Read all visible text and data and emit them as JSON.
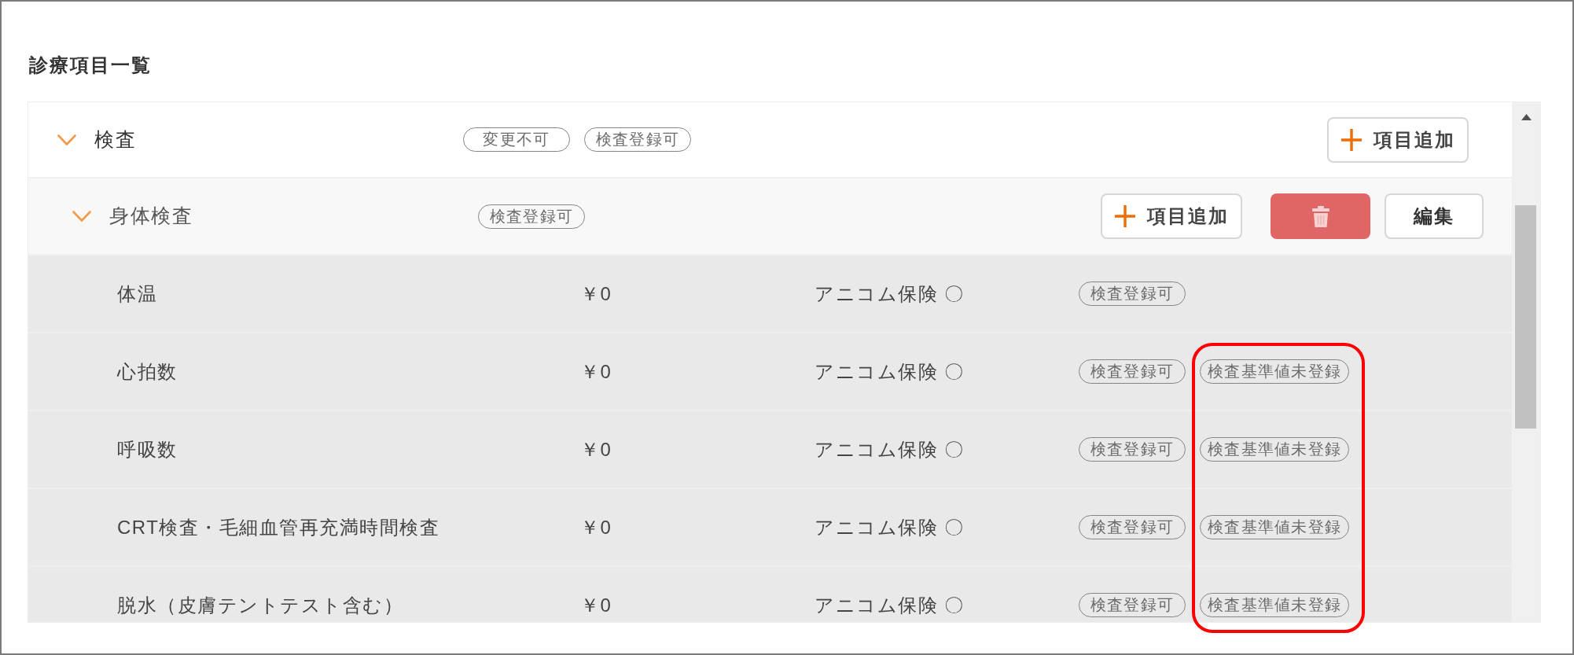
{
  "title": "診療項目一覧",
  "categories": [
    {
      "name": "検査",
      "expanded": true,
      "tags": [
        "変更不可",
        "検査登録可"
      ],
      "add_button": "項目追加",
      "children": [
        {
          "name": "身体検査",
          "expanded": true,
          "tags": [
            "検査登録可"
          ],
          "add_button": "項目追加",
          "delete_button": true,
          "edit_button": "編集",
          "items": [
            {
              "name": "体温",
              "price": "￥0",
              "insurance": "アニコム保険 〇",
              "tags": [
                {
                  "label": "検査登録可",
                  "highlighted": false
                }
              ]
            },
            {
              "name": "心拍数",
              "price": "￥0",
              "insurance": "アニコム保険 〇",
              "tags": [
                {
                  "label": "検査登録可",
                  "highlighted": false
                },
                {
                  "label": "検査基準値未登録",
                  "highlighted": true
                }
              ]
            },
            {
              "name": "呼吸数",
              "price": "￥0",
              "insurance": "アニコム保険 〇",
              "tags": [
                {
                  "label": "検査登録可",
                  "highlighted": false
                },
                {
                  "label": "検査基準値未登録",
                  "highlighted": true
                }
              ]
            },
            {
              "name": "CRT検査・毛細血管再充満時間検査",
              "price": "￥0",
              "insurance": "アニコム保険 〇",
              "tags": [
                {
                  "label": "検査登録可",
                  "highlighted": false
                },
                {
                  "label": "検査基準値未登録",
                  "highlighted": true
                }
              ]
            },
            {
              "name": "脱水（皮膚テントテスト含む）",
              "price": "￥0",
              "insurance": "アニコム保険 〇",
              "tags": [
                {
                  "label": "検査登録可",
                  "highlighted": false
                },
                {
                  "label": "検査基準値未登録",
                  "highlighted": true
                }
              ]
            }
          ]
        }
      ]
    }
  ]
}
